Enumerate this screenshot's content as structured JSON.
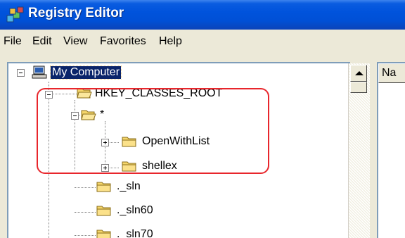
{
  "window": {
    "title": "Registry Editor"
  },
  "menu": [
    "File",
    "Edit",
    "View",
    "Favorites",
    "Help"
  ],
  "tree": {
    "root": "My Computer",
    "hkcr": "HKEY_CLASSES_ROOT",
    "star": "*",
    "openwithlist": "OpenWithList",
    "shellex": "shellex",
    "sln": "._sln",
    "sln60": "._sln60",
    "sln70": "._sln70"
  },
  "list_pane": {
    "column_header": "Na"
  },
  "colors": {
    "titlebar": "#0053dc",
    "selection": "#0a246a",
    "highlight": "#e8262c",
    "folder": "#f5d66b"
  }
}
